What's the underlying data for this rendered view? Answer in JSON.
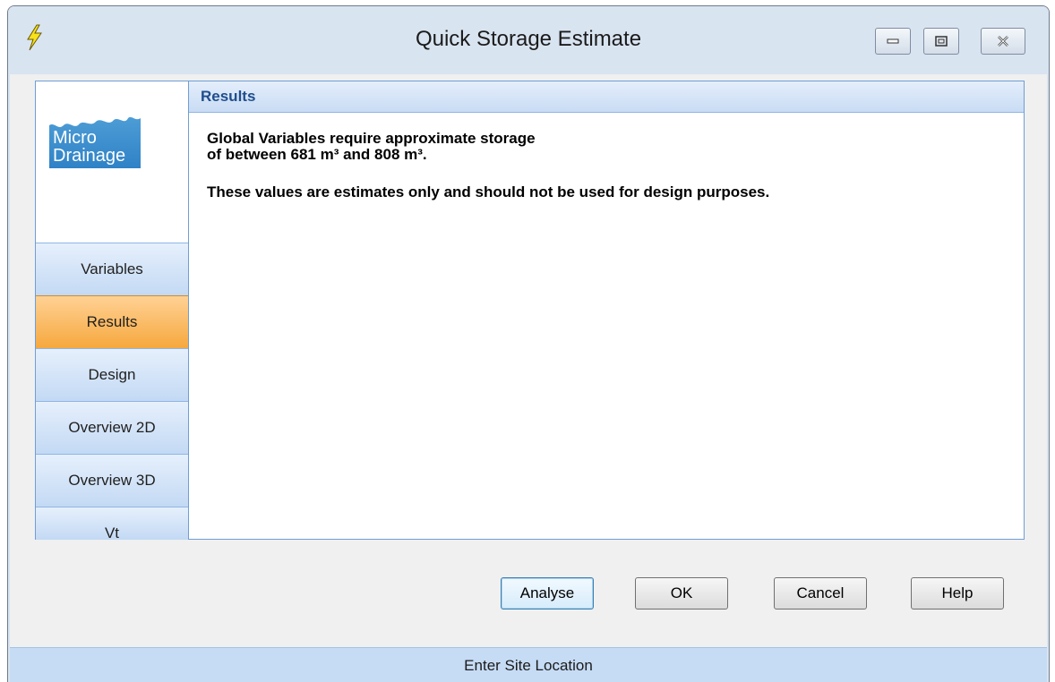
{
  "window": {
    "title": "Quick Storage Estimate"
  },
  "logo": {
    "line1": "Micro",
    "line2": "Drainage"
  },
  "nav": {
    "items": [
      {
        "label": "Variables",
        "active": false
      },
      {
        "label": "Results",
        "active": true
      },
      {
        "label": "Design",
        "active": false
      },
      {
        "label": "Overview 2D",
        "active": false
      },
      {
        "label": "Overview 3D",
        "active": false
      },
      {
        "label": "Vt",
        "active": false
      }
    ]
  },
  "content": {
    "header": "Results",
    "line1": "Global Variables require approximate storage",
    "line2": "of between 681 m³ and 808 m³.",
    "line3": "These values are estimates only and should not be used for design purposes."
  },
  "buttons": {
    "analyse": "Analyse",
    "ok": "OK",
    "cancel": "Cancel",
    "help": "Help"
  },
  "status": {
    "text": "Enter Site Location"
  },
  "colors": {
    "accent": "#1f4e8c",
    "active_tab": "#f6a83d",
    "tab_blue": "#c3d9f4",
    "status_bar": "#c6dcf5"
  },
  "icons": {
    "app": "lightning-bolt-icon",
    "minimize": "minimize-icon",
    "maximize": "maximize-icon",
    "close": "close-icon"
  }
}
